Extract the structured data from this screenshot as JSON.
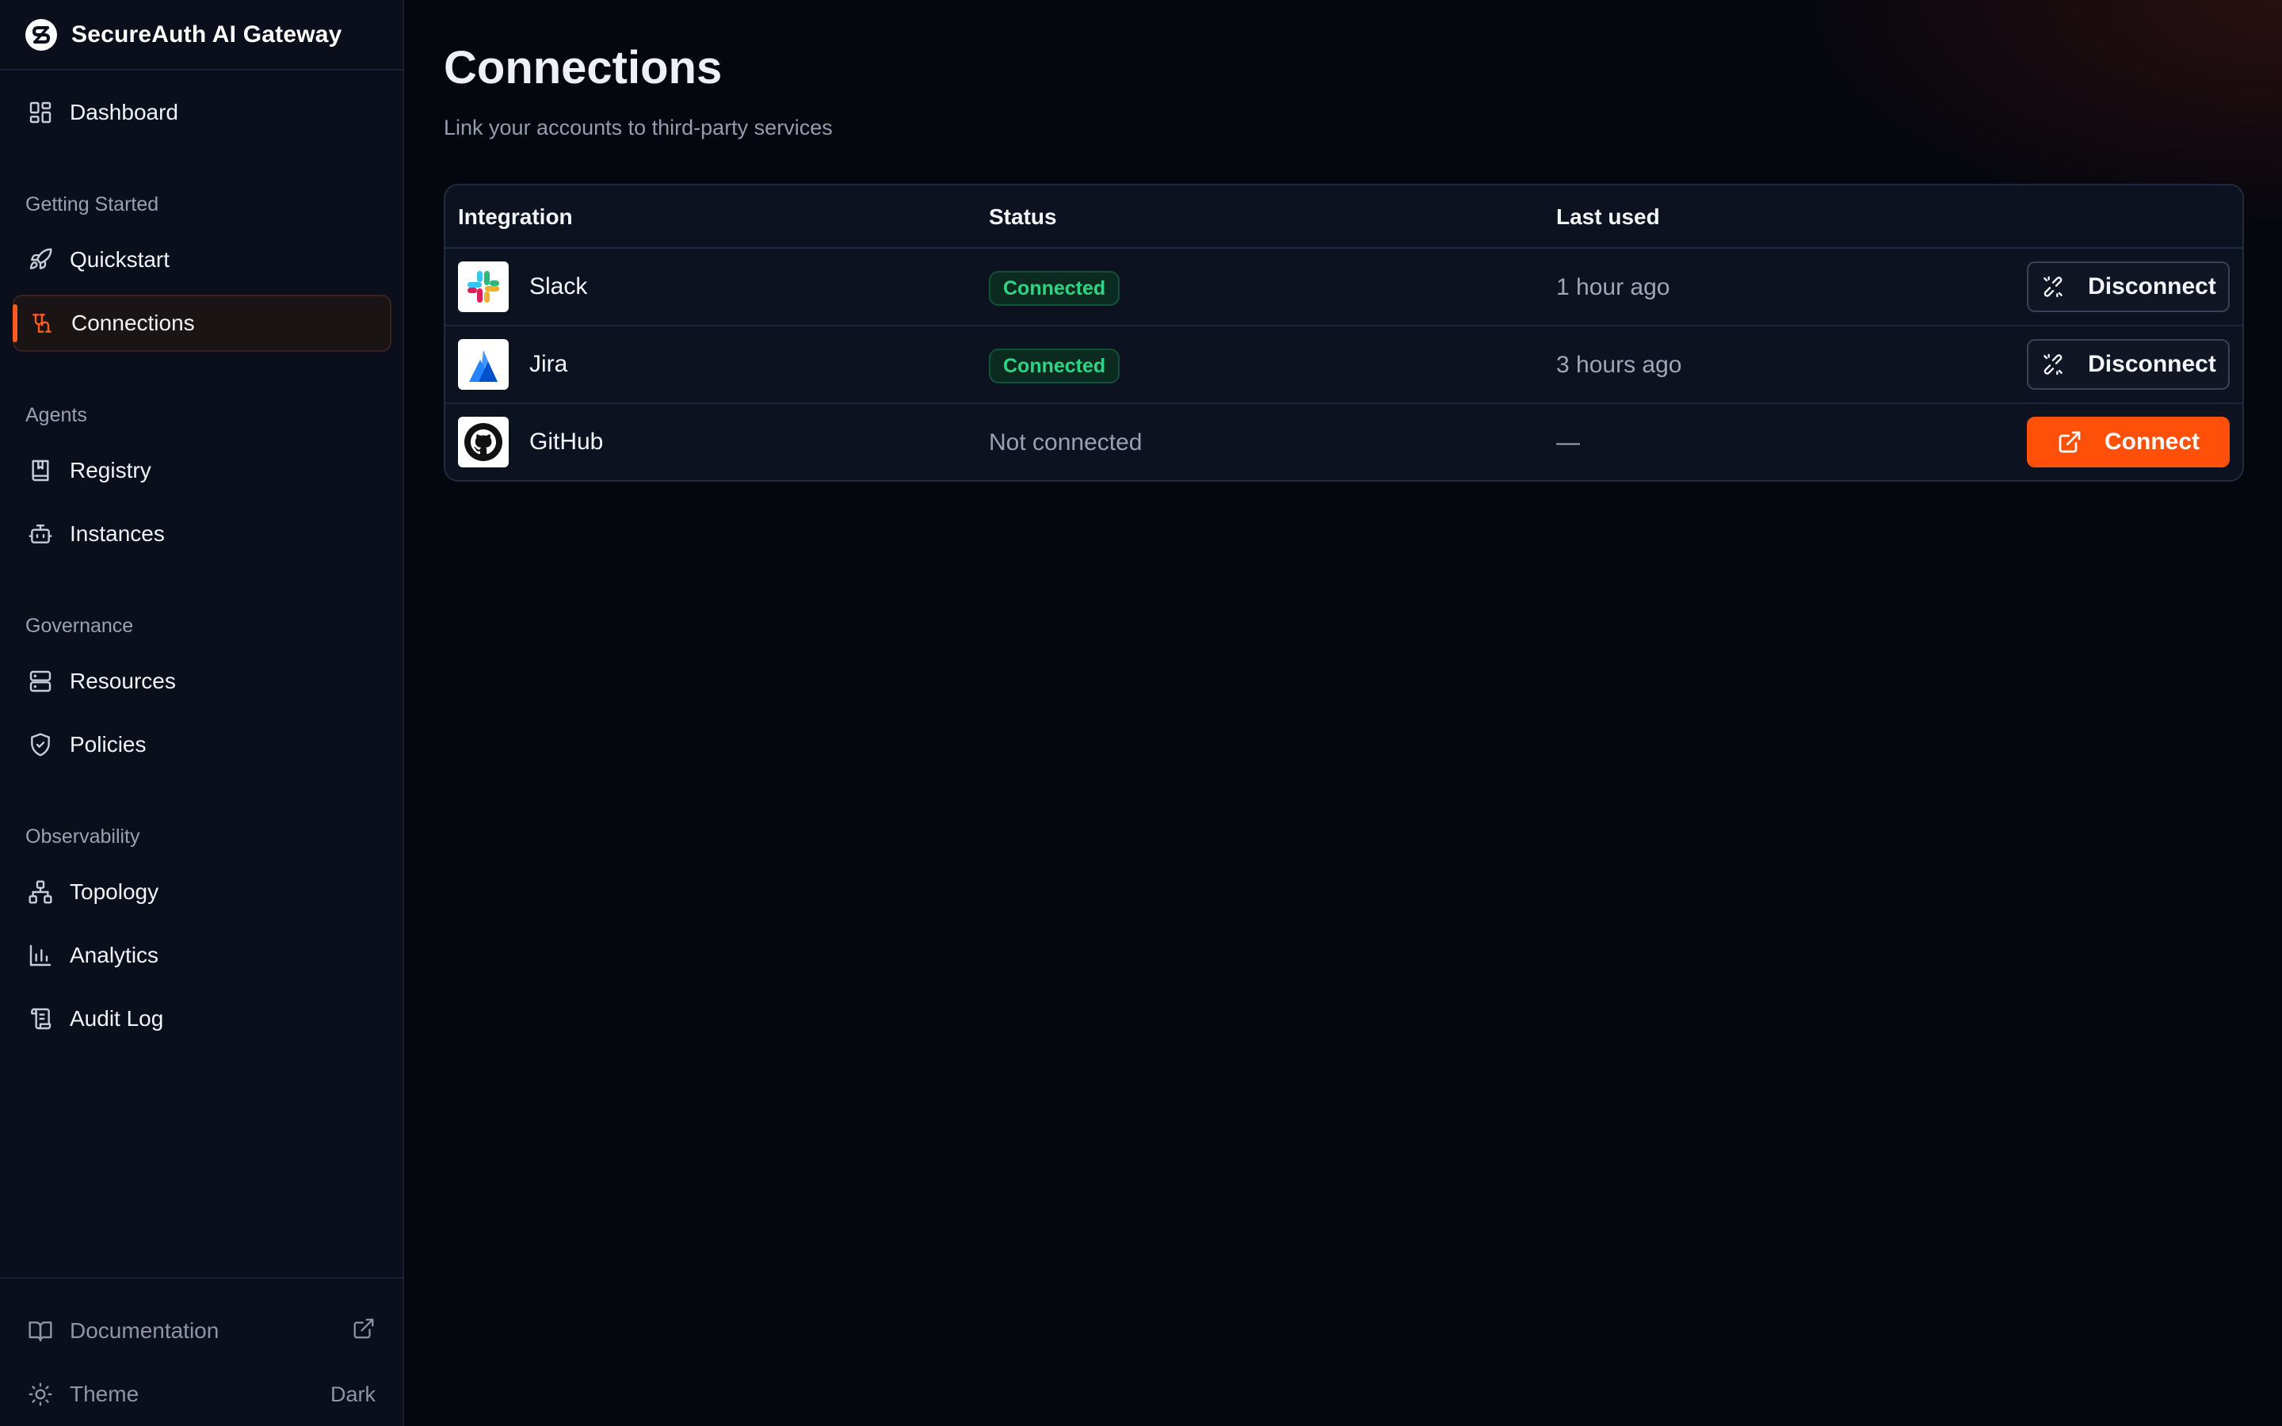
{
  "app": {
    "title": "SecureAuth AI Gateway"
  },
  "sidebar": {
    "dashboard": {
      "label": "Dashboard",
      "icon": "dashboard-icon"
    },
    "sections": [
      {
        "label": "Getting Started",
        "items": [
          {
            "label": "Quickstart",
            "icon": "rocket-icon"
          },
          {
            "label": "Connections",
            "icon": "connection-icon",
            "active": true
          }
        ]
      },
      {
        "label": "Agents",
        "items": [
          {
            "label": "Registry",
            "icon": "book-icon"
          },
          {
            "label": "Instances",
            "icon": "bot-icon"
          }
        ]
      },
      {
        "label": "Governance",
        "items": [
          {
            "label": "Resources",
            "icon": "server-icon"
          },
          {
            "label": "Policies",
            "icon": "shield-icon"
          }
        ]
      },
      {
        "label": "Observability",
        "items": [
          {
            "label": "Topology",
            "icon": "topology-icon"
          },
          {
            "label": "Analytics",
            "icon": "bar-chart-icon"
          },
          {
            "label": "Audit Log",
            "icon": "scroll-icon"
          }
        ]
      }
    ],
    "footer": {
      "documentation": {
        "label": "Documentation",
        "icon": "book-open-icon",
        "trailing_icon": "external-link-icon"
      },
      "theme": {
        "label": "Theme",
        "value": "Dark",
        "icon": "sun-icon"
      }
    }
  },
  "main": {
    "title": "Connections",
    "subtitle": "Link your accounts to third-party services",
    "table": {
      "headers": {
        "integration": "Integration",
        "status": "Status",
        "last_used": "Last used"
      },
      "rows": [
        {
          "name": "Slack",
          "icon": "slack-icon",
          "status": "Connected",
          "connected": true,
          "last_used": "1 hour ago",
          "action": "Disconnect"
        },
        {
          "name": "Jira",
          "icon": "jira-icon",
          "status": "Connected",
          "connected": true,
          "last_used": "3 hours ago",
          "action": "Disconnect"
        },
        {
          "name": "GitHub",
          "icon": "github-icon",
          "status": "Not connected",
          "connected": false,
          "last_used": "—",
          "action": "Connect"
        }
      ]
    }
  },
  "colors": {
    "accent": "#ff5009",
    "success": "#2fd584",
    "background": "#05070e",
    "sidebar": "#0b0f1c"
  }
}
